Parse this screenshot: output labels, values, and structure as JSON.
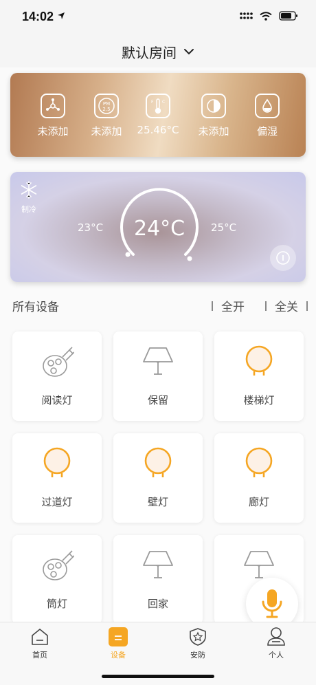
{
  "status_bar": {
    "time": "14:02"
  },
  "header": {
    "room_title": "默认房间"
  },
  "env_card": {
    "items": [
      {
        "icon": "fan-icon",
        "label": "未添加"
      },
      {
        "icon": "pm25-icon",
        "label": "未添加"
      },
      {
        "icon": "thermometer-icon",
        "label": "25.46°C"
      },
      {
        "icon": "light-sensor-icon",
        "label": "未添加"
      },
      {
        "icon": "humidity-icon",
        "label": "偏湿"
      }
    ],
    "pm_badge_line1": "PM",
    "pm_badge_line2": "2.5",
    "thermo_f": "F",
    "thermo_c": "C"
  },
  "ac_card": {
    "mode_label": "制冷",
    "min_temp": "23°C",
    "current_temp": "24°C",
    "max_temp": "25°C"
  },
  "devices": {
    "title": "所有设备",
    "all_on": "全开",
    "all_off": "全关",
    "items": [
      {
        "label": "阅读灯",
        "icon": "spotlight-icon"
      },
      {
        "label": "保留",
        "icon": "lamp-icon"
      },
      {
        "label": "楼梯灯",
        "icon": "bulb-icon"
      },
      {
        "label": "过道灯",
        "icon": "bulb-icon"
      },
      {
        "label": "壁灯",
        "icon": "bulb-icon"
      },
      {
        "label": "廊灯",
        "icon": "bulb-icon"
      },
      {
        "label": "筒灯",
        "icon": "spotlight-icon"
      },
      {
        "label": "回家",
        "icon": "lamp-icon"
      },
      {
        "label": "",
        "icon": "lamp-icon"
      }
    ]
  },
  "tabbar": {
    "tabs": [
      {
        "label": "首页",
        "icon": "home-icon"
      },
      {
        "label": "设备",
        "icon": "device-icon"
      },
      {
        "label": "安防",
        "icon": "shield-icon"
      },
      {
        "label": "个人",
        "icon": "person-icon"
      }
    ]
  },
  "colors": {
    "accent": "#f5a623",
    "bulb_fill": "#fdf1e6",
    "icon_grey": "#9a9a9a"
  }
}
